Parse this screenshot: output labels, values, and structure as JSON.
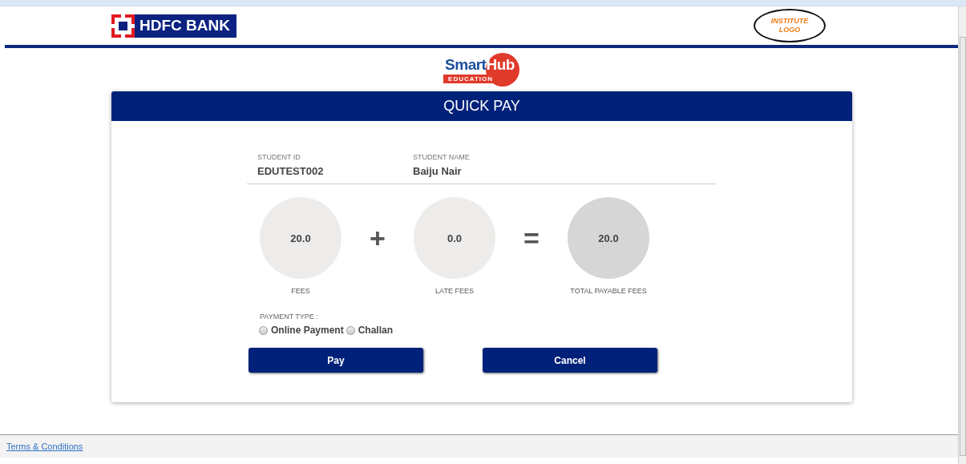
{
  "header": {
    "bank_logo": "HDFC BANK",
    "institute_logo": [
      "INSTITUTE",
      "LOGO"
    ],
    "brand_logo": {
      "name_dark": "Smart",
      "name_light": "Hub",
      "tagline": "EDUCATION"
    }
  },
  "card": {
    "title": "QUICK PAY",
    "student": [
      {
        "label": "STUDENT ID",
        "value": "EDUTEST002"
      },
      {
        "label": "STUDENT NAME",
        "value": "Baiju Nair"
      }
    ],
    "fees": [
      {
        "kind": "amount",
        "value": "20.0",
        "label": "FEES"
      },
      {
        "kind": "operator",
        "symbol": "+"
      },
      {
        "kind": "amount",
        "value": "0.0",
        "label": "LATE FEES"
      },
      {
        "kind": "operator",
        "symbol": "="
      },
      {
        "kind": "total",
        "value": "20.0",
        "label": "TOTAL PAYABLE FEES"
      }
    ],
    "payment_type": {
      "label": "PAYMENT TYPE :",
      "options": [
        {
          "label": "Online Payment",
          "checked": false
        },
        {
          "label": "Challan",
          "checked": false
        }
      ]
    },
    "buttons": [
      "Pay",
      "Cancel"
    ]
  },
  "footer": {
    "link": "Terms & Conditions"
  }
}
